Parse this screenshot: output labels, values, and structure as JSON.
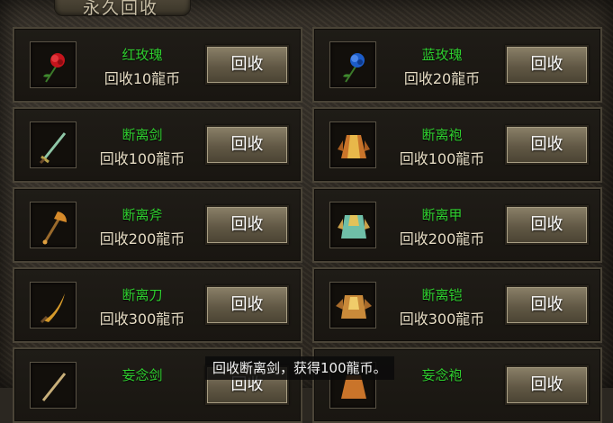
{
  "panel": {
    "title": "永久回收"
  },
  "items": [
    {
      "name": "红玫瑰",
      "price": "回收10龍币",
      "button": "回收",
      "icon": "red-rose-icon"
    },
    {
      "name": "蓝玫瑰",
      "price": "回收20龍币",
      "button": "回收",
      "icon": "blue-rose-icon"
    },
    {
      "name": "断离剑",
      "price": "回收100龍币",
      "button": "回收",
      "icon": "sword-icon"
    },
    {
      "name": "断离袍",
      "price": "回收100龍币",
      "button": "回收",
      "icon": "robe-icon"
    },
    {
      "name": "断离斧",
      "price": "回收200龍币",
      "button": "回收",
      "icon": "axe-icon"
    },
    {
      "name": "断离甲",
      "price": "回收200龍币",
      "button": "回收",
      "icon": "armor-icon"
    },
    {
      "name": "断离刀",
      "price": "回收300龍币",
      "button": "回收",
      "icon": "blade-icon"
    },
    {
      "name": "断离铠",
      "price": "回收300龍币",
      "button": "回收",
      "icon": "mail-armor-icon"
    },
    {
      "name": "妄念剑",
      "price": "",
      "button": "回收",
      "icon": "sword-icon"
    },
    {
      "name": "妄念袍",
      "price": "",
      "button": "回收",
      "icon": "robe-icon"
    }
  ],
  "toast": {
    "message": "回收断离剑，获得100龍币。"
  },
  "colors": {
    "item_name": "#2fcf2f",
    "price_text": "#e6dcc4",
    "button_bg": "#6e6552"
  }
}
